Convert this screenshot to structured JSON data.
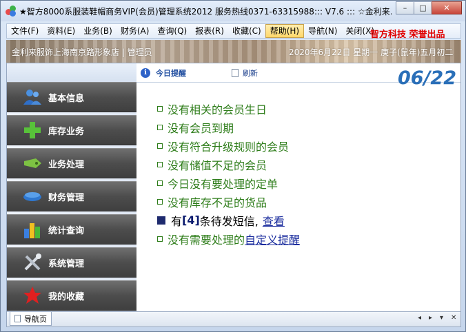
{
  "window": {
    "title": "★智方8000系服装鞋帽商务VIP(会员)管理系统2012 服务热线0371-63315988::: V7.6  ::: ☆金利来...",
    "min_symbol": "–",
    "max_symbol": "□",
    "close_symbol": "✕"
  },
  "menu": {
    "items": [
      "文件(F)",
      "资料(E)",
      "业务(B)",
      "财务(A)",
      "查询(Q)",
      "报表(R)",
      "收藏(C)",
      "帮助(H)",
      "导航(N)",
      "关闭(X)"
    ],
    "active_index": 7,
    "brand": "智方科技 荣誉出品"
  },
  "banner": {
    "store": "金利来服饰上海南京路形象店 | 管理员",
    "date": "2020年6月22日  星期一  庚子(鼠年)五月初二"
  },
  "sidebar": {
    "items": [
      {
        "label": "基本信息",
        "icon": "users-icon"
      },
      {
        "label": "库存业务",
        "icon": "plus-icon"
      },
      {
        "label": "业务处理",
        "icon": "tag-icon"
      },
      {
        "label": "财务管理",
        "icon": "wallet-icon"
      },
      {
        "label": "统计查询",
        "icon": "bar-chart-icon"
      },
      {
        "label": "系统管理",
        "icon": "tools-icon"
      },
      {
        "label": "我的收藏",
        "icon": "star-icon"
      }
    ]
  },
  "content": {
    "tab_today": "今日提醒",
    "tab_refresh": "刷新",
    "date_display": "06/22",
    "reminders": [
      "没有相关的会员生日",
      "没有会员到期",
      "没有符合升级规则的会员",
      "没有储值不足的会员",
      "今日没有要处理的定单",
      "没有库存不足的货品"
    ],
    "sms": {
      "prefix": "有",
      "count": "[4]",
      "suffix": "条待发短信,",
      "link": "查看"
    },
    "custom": {
      "prefix": "没有需要处理的",
      "link": "自定义提醒"
    }
  },
  "bottom": {
    "tab_label": "导航页",
    "prev": "◂",
    "next": "▸",
    "down": "▾",
    "close": "✕"
  },
  "colors": {
    "reminder_green": "#2e7d1a",
    "date_blue": "#2a6fb8",
    "brand_red": "#e00000",
    "link_blue": "#1b2d9e"
  }
}
